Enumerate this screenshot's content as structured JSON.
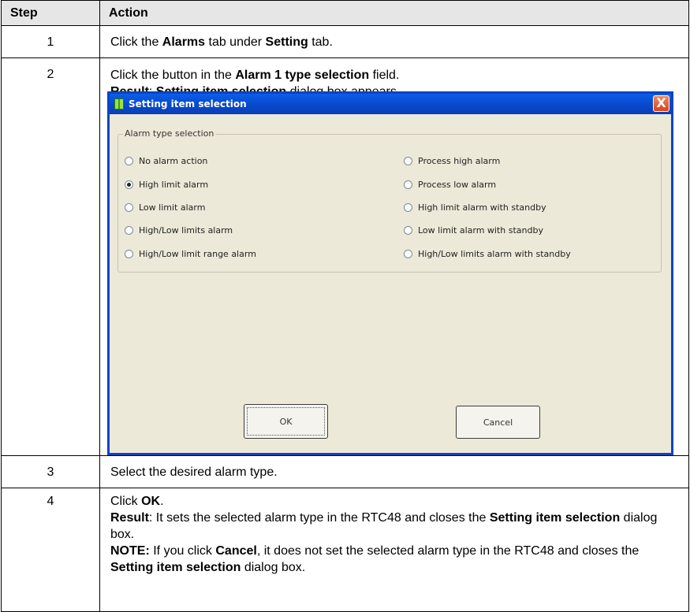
{
  "table": {
    "headers": {
      "step": "Step",
      "action": "Action"
    },
    "row1": {
      "step": "1",
      "parts": [
        "Click the ",
        "Alarms",
        " tab under ",
        "Setting",
        " tab."
      ]
    },
    "row2": {
      "step": "2",
      "line1": [
        "Click the button in the ",
        "Alarm 1 type selection",
        " field."
      ],
      "line2": [
        "Result",
        ": ",
        "Setting item selection",
        " dialog box appears."
      ]
    },
    "row3": {
      "step": "3",
      "text": "Select the desired alarm type."
    },
    "row4": {
      "step": "4",
      "l1": [
        "Click ",
        "OK",
        "."
      ],
      "l2": [
        "Result",
        ": It sets the selected alarm type in the RTC48 and closes the ",
        "Setting item selection",
        " dialog box."
      ],
      "l3": [
        "NOTE:",
        " If you click ",
        "Cancel",
        ", it does not set the selected alarm type in the RTC48 and closes the ",
        "Setting item selection",
        " dialog box."
      ]
    }
  },
  "dialog": {
    "title": "Setting item selection",
    "close_label": "X",
    "group_label": "Alarm type selection",
    "options_left": [
      "No alarm action",
      "High limit alarm",
      "Low limit alarm",
      "High/Low limits alarm",
      "High/Low limit range alarm"
    ],
    "options_right": [
      "Process high alarm",
      "Process low alarm",
      "High limit alarm with standby",
      "Low limit alarm with standby",
      "High/Low limits alarm with standby"
    ],
    "selected": "High limit alarm",
    "ok_label": "OK",
    "cancel_label": "Cancel"
  }
}
